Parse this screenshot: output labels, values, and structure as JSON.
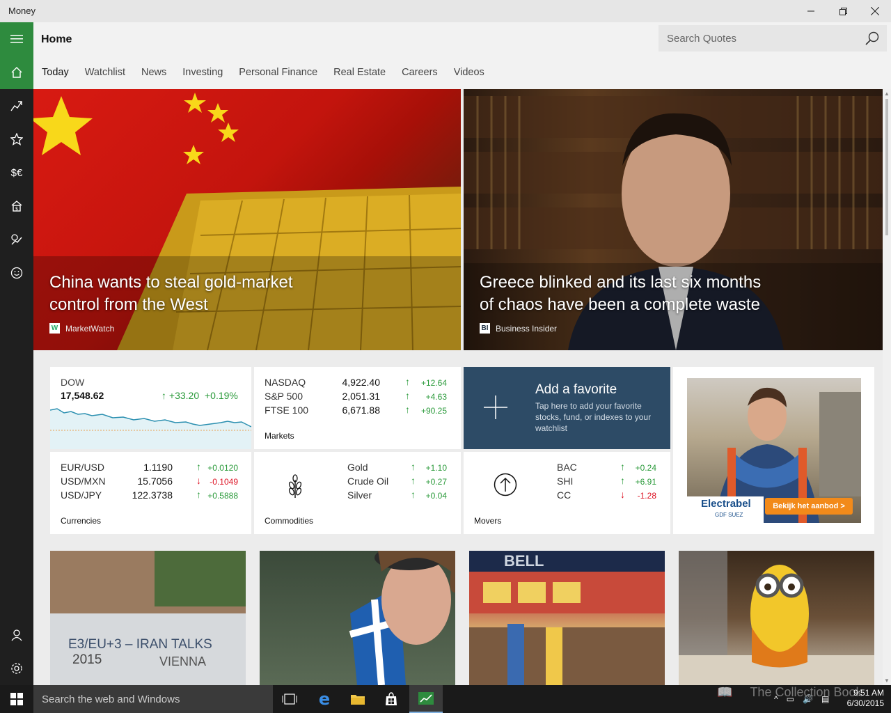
{
  "window": {
    "title": "Money"
  },
  "header": {
    "page_title": "Home",
    "search_placeholder": "Search Quotes"
  },
  "tabs": [
    "Today",
    "Watchlist",
    "News",
    "Investing",
    "Personal Finance",
    "Real Estate",
    "Careers",
    "Videos"
  ],
  "sidebar": {
    "icons": [
      "hamburger-icon",
      "home-icon",
      "chart-trend-icon",
      "star-icon",
      "currency-icon",
      "real-estate-icon",
      "investing-icon",
      "smiley-icon",
      "user-icon",
      "settings-icon"
    ]
  },
  "hero": [
    {
      "headline": "China wants to steal gold-market control from the West",
      "source": "MarketWatch",
      "source_logo": "W"
    },
    {
      "headline": "Greece blinked and its last six months of chaos have been a complete waste",
      "source": "Business Insider",
      "source_logo": "BI"
    }
  ],
  "dow": {
    "name": "DOW",
    "value": "17,548.62",
    "change": "+33.20",
    "pct": "+0.19%"
  },
  "markets": {
    "label": "Markets",
    "rows": [
      {
        "name": "NASDAQ",
        "value": "4,922.40",
        "change": "+12.64"
      },
      {
        "name": "S&P 500",
        "value": "2,051.31",
        "change": "+4.63"
      },
      {
        "name": "FTSE 100",
        "value": "6,671.88",
        "change": "+90.25"
      }
    ]
  },
  "favorite": {
    "title": "Add a favorite",
    "desc": "Tap here to add your favorite stocks, fund, or indexes to your watchlist"
  },
  "currencies": {
    "label": "Currencies",
    "rows": [
      {
        "name": "EUR/USD",
        "value": "1.1190",
        "change": "+0.0120",
        "dir": "up"
      },
      {
        "name": "USD/MXN",
        "value": "15.7056",
        "change": "-0.1049",
        "dir": "down"
      },
      {
        "name": "USD/JPY",
        "value": "122.3738",
        "change": "+0.5888",
        "dir": "up"
      }
    ]
  },
  "commodities": {
    "label": "Commodities",
    "rows": [
      {
        "name": "Gold",
        "change": "+1.10"
      },
      {
        "name": "Crude Oil",
        "change": "+0.27"
      },
      {
        "name": "Silver",
        "change": "+0.04"
      }
    ]
  },
  "movers": {
    "label": "Movers",
    "rows": [
      {
        "name": "BAC",
        "change": "+0.24",
        "dir": "up"
      },
      {
        "name": "SHI",
        "change": "+6.91",
        "dir": "up"
      },
      {
        "name": "CC",
        "change": "-1.28",
        "dir": "down"
      }
    ]
  },
  "ad": {
    "brand": "Electrabel",
    "brand_sub": "GDF SUEZ",
    "cta": "Bekijk het aanbod  >"
  },
  "news_images": [
    {
      "caption_line1": "E3/EU+3 – IRAN TALKS",
      "caption_year": "2015",
      "caption_line2": "VIENNA"
    },
    {
      "caption_line1": ""
    },
    {
      "caption_line1": "BELL"
    },
    {
      "caption_line1": ""
    }
  ],
  "taskbar": {
    "search_placeholder": "Search the web and Windows",
    "time": "9:51 AM",
    "date": "6/30/2015",
    "watermark": "The Collection Book"
  }
}
